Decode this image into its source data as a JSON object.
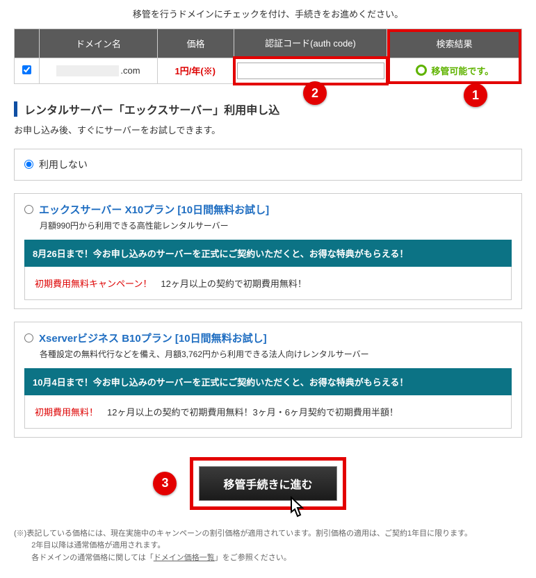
{
  "instruction": "移管を行うドメインにチェックを付け、手続きをお進めください。",
  "table": {
    "headers": {
      "domain": "ドメイン名",
      "price": "価格",
      "auth": "認証コード(auth code)",
      "result": "検索結果"
    },
    "row": {
      "tld": ".com",
      "price": "1円/年(※)",
      "auth_value": "",
      "result_text": "移管可能です。"
    }
  },
  "section": {
    "title_prefix": "レンタルサーバー「エックスサーバー」利用申し込",
    "sub": "お申し込み後、すぐにサーバーをお試しできます。"
  },
  "options": {
    "none_label": "利用しない",
    "x10": {
      "title": "エックスサーバー X10プラン [10日間無料お試し]",
      "desc": "月額990円から利用できる高性能レンタルサーバー",
      "banner": "8月26日まで！今お申し込みのサーバーを正式にご契約いただくと、お得な特典がもらえる！",
      "campaign_label": "初期費用無料キャンペーン！",
      "campaign_text": "　12ヶ月以上の契約で初期費用無料！"
    },
    "b10": {
      "title": "Xserverビジネス B10プラン [10日間無料お試し]",
      "desc": "各種設定の無料代行などを備え、月額3,762円から利用できる法人向けレンタルサーバー",
      "banner": "10月4日まで！今お申し込みのサーバーを正式にご契約いただくと、お得な特典がもらえる！",
      "campaign_label": "初期費用無料！",
      "campaign_text": "　12ヶ月以上の契約で初期費用無料！3ヶ月・6ヶ月契約で初期費用半額！"
    }
  },
  "submit_label": "移管手続きに進む",
  "badges": {
    "one": "1",
    "two": "2",
    "three": "3"
  },
  "footnotes": {
    "l1": "(※)表記している価格には、現在実施中のキャンペーンの割引価格が適用されています。割引価格の適用は、ご契約1年目に限ります。",
    "l2": "2年目以降は通常価格が適用されます。",
    "l3a": "各ドメインの通常価格に関しては「",
    "l3link": "ドメイン価格一覧",
    "l3b": "」をご参照ください。"
  }
}
